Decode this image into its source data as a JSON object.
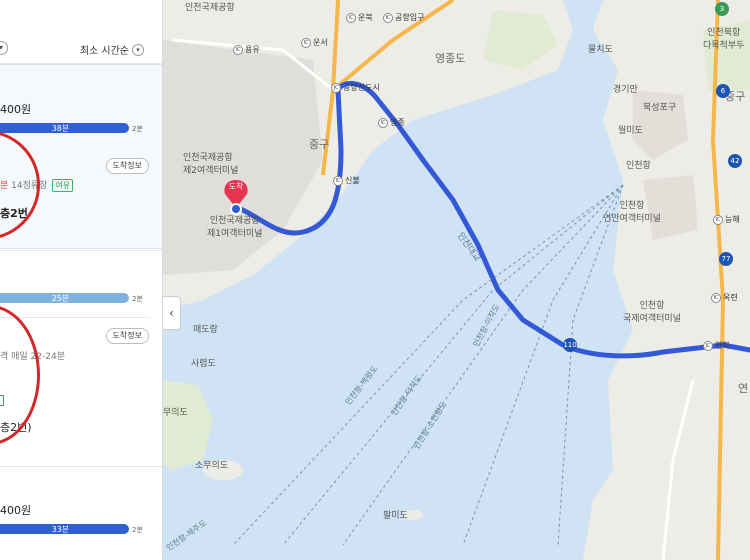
{
  "panel": {
    "sort_label": "최소 시간순",
    "card1": {
      "fare": "400원",
      "bar_time": "38분",
      "bar_end": "2분",
      "info_button": "도착정보",
      "detail_red": "분",
      "detail_gray": "14정류장",
      "detail_tag": "여유",
      "gate": "층2번"
    },
    "card2": {
      "bar_time": "25분",
      "bar_end": "2분",
      "info_button": "도착정보",
      "detail": "격 매일 22-24분",
      "gate": "층2번)"
    },
    "card3": {
      "fare": "400원",
      "bar_time": "33분",
      "bar_end": "2분"
    }
  },
  "map": {
    "labels": {
      "incheon_airport_t2": "인천국제공항\n제2여객터미널",
      "incheon_airport_t1": "인천국제공항\n제1여객터미널",
      "arrival_pin": "도착",
      "junggu": "중구",
      "yeongjongdo": "영종도",
      "yeongjongdo_top": "영종도",
      "mudo": "매도랑",
      "sarido": "사렴도",
      "pumuido": "무의도",
      "somuido": "소무의도",
      "palmido": "팔미도",
      "incheon_bridge": "인천대교",
      "wolmido": "월미도",
      "incheon_inner": "인천항",
      "yeonan_terminal": "인천항\n연안여객터미널",
      "intl_terminal": "인천항\n국제여객터미널",
      "bukseong": "북성포구",
      "gyeongin": "경기만",
      "mulchi": "물치도",
      "north_terminal": "인천북항\n다목적부두",
      "junggu_right": "중구",
      "yeon": "연"
    },
    "ics": {
      "ic_unbuk": "운북",
      "ic_airport_entry": "공항입구",
      "ic_yongyu": "용유",
      "ic_unseo": "운서",
      "jc_airport_newcity": "공항신도시",
      "ic_yeongjong": "영종",
      "ic_sinbul": "신불",
      "ic_neungheo": "능해",
      "ic_ongnyeon": "옥련",
      "jc_yeonhak": "연학"
    },
    "routes": {
      "r1": "인천항-덕적도",
      "r2": "인천항-백령도",
      "r3": "인천항-이작도",
      "r4": "인천항-소연평도",
      "r5": "인천항-제주도"
    },
    "shields": {
      "s110": "110",
      "s6": "6",
      "s42": "42",
      "s77": "77",
      "s3": "3"
    },
    "colors": {
      "route": "#3459d6",
      "road": "#f6b74a",
      "land": "#f2f1ed",
      "sea": "#cfe3f5",
      "pin": "#e5344d"
    }
  }
}
